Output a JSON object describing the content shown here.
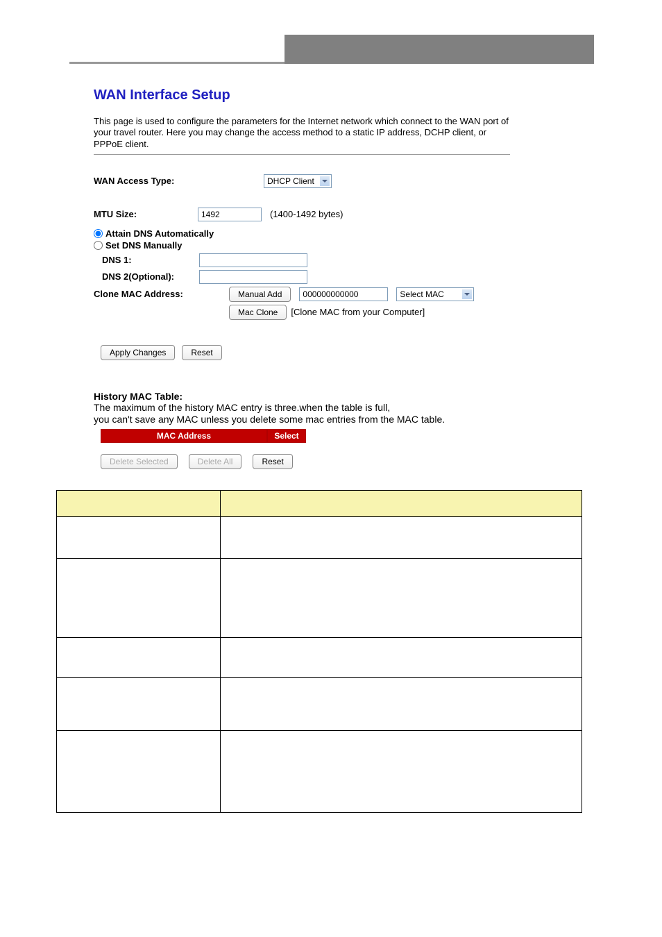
{
  "title": "WAN Interface Setup",
  "intro": "This page is used to configure the parameters for the Internet network which connect to the WAN port of your travel router. Here you may change the access method to a static IP address, DCHP client, or PPPoE client.",
  "fields": {
    "wan_access_type_label": "WAN Access Type:",
    "wan_access_type_value": "DHCP Client",
    "mtu_label": "MTU Size:",
    "mtu_value": "1492",
    "mtu_hint": "(1400-1492 bytes)",
    "dns_auto_label": "Attain DNS Automatically",
    "dns_manual_label": "Set DNS Manually",
    "dns1_label": "DNS 1:",
    "dns1_value": "",
    "dns2_label": "DNS 2(Optional):",
    "dns2_value": "",
    "clone_label": "Clone MAC Address:",
    "manual_add_btn": "Manual Add",
    "mac_value": "000000000000",
    "select_mac_value": "Select MAC",
    "mac_clone_btn": "Mac Clone",
    "mac_clone_hint": "[Clone MAC from your Computer]",
    "apply_btn": "Apply Changes",
    "reset_btn": "Reset"
  },
  "history": {
    "title": "History MAC Table:",
    "text1": "The maximum of the history MAC entry is three.when the table is full,",
    "text2": "you can't save any MAC unless you delete some mac entries from the MAC table.",
    "col_mac": "MAC Address",
    "col_select": "Select",
    "delete_selected": "Delete Selected",
    "delete_all": "Delete All",
    "reset": "Reset"
  }
}
